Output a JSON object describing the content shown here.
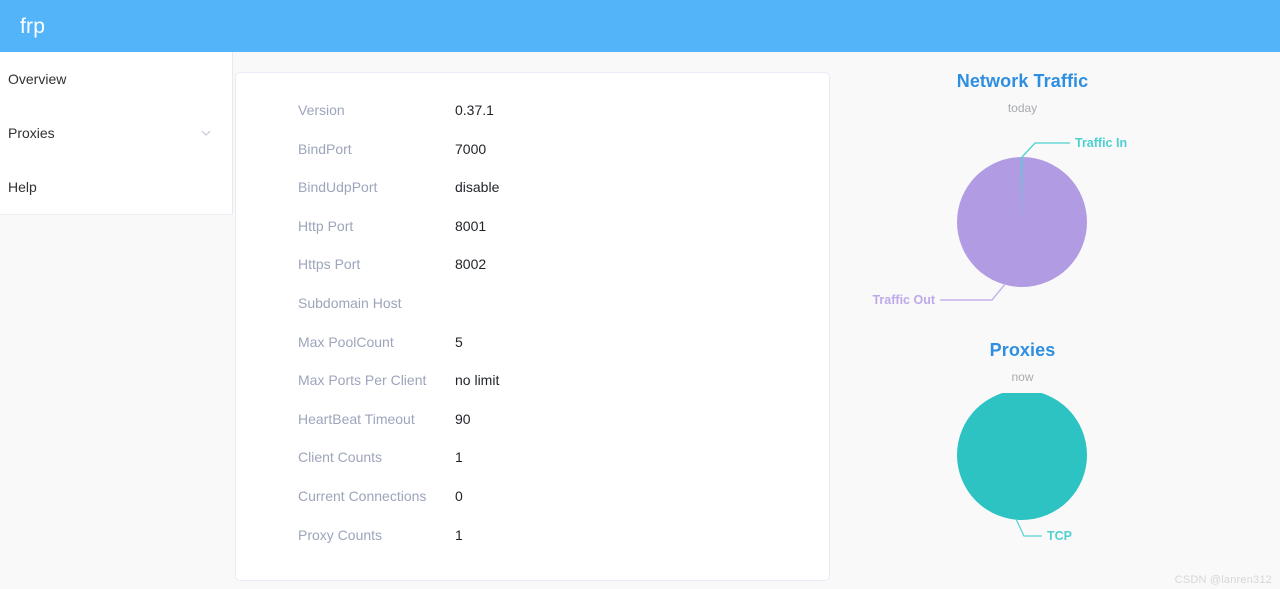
{
  "header": {
    "brand": "frp",
    "background_color": "#54b4f9"
  },
  "sidebar": {
    "items": [
      {
        "label": "Overview",
        "icon": "",
        "has_chevron": false,
        "active": true
      },
      {
        "label": "Proxies",
        "icon": "chevron-down-icon",
        "has_chevron": true,
        "active": false
      },
      {
        "label": "Help",
        "icon": "",
        "has_chevron": false,
        "active": false
      }
    ]
  },
  "server_info": {
    "rows": [
      {
        "key": "Version",
        "value": "0.37.1"
      },
      {
        "key": "BindPort",
        "value": "7000"
      },
      {
        "key": "BindUdpPort",
        "value": "disable"
      },
      {
        "key": "Http Port",
        "value": "8001"
      },
      {
        "key": "Https Port",
        "value": "8002"
      },
      {
        "key": "Subdomain Host",
        "value": ""
      },
      {
        "key": "Max PoolCount",
        "value": "5"
      },
      {
        "key": "Max Ports Per Client",
        "value": "no limit"
      },
      {
        "key": "HeartBeat Timeout",
        "value": "90"
      },
      {
        "key": "Client Counts",
        "value": "1"
      },
      {
        "key": "Current Connections",
        "value": "0"
      },
      {
        "key": "Proxy Counts",
        "value": "1"
      }
    ]
  },
  "chart_data": [
    {
      "type": "pie",
      "title": "Network Traffic",
      "subtitle": "today",
      "categories": [
        "Traffic In",
        "Traffic Out"
      ],
      "values": [
        0.4,
        99.6
      ],
      "colors": [
        "#4dd0d0",
        "#b19ce4"
      ],
      "labels": [
        "Traffic In",
        "Traffic Out"
      ],
      "legend": "callout-labels",
      "title_color": "#2e8ee0",
      "subtitle_color": "#a9abae"
    },
    {
      "type": "pie",
      "title": "Proxies",
      "subtitle": "now",
      "categories": [
        "TCP"
      ],
      "values": [
        100
      ],
      "colors": [
        "#2dc3c3"
      ],
      "labels": [
        "TCP"
      ],
      "legend": "callout-labels",
      "title_color": "#2e8ee0",
      "subtitle_color": "#a9abae"
    }
  ],
  "watermark": {
    "text": "CSDN @lanren312"
  }
}
